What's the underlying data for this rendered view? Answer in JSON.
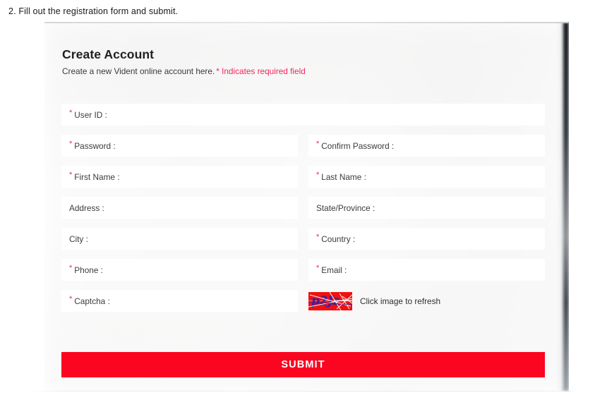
{
  "caption": "2. Fill out the registration form and submit.",
  "form": {
    "title": "Create Account",
    "subtitle": "Create a new Vident online account here.",
    "required_note": "* Indicates required field",
    "required_marker": "*",
    "rows": [
      {
        "left": {
          "label": "User ID :",
          "required": true,
          "value": "",
          "placeholder": ""
        },
        "right": null
      },
      {
        "left": {
          "label": "Password :",
          "required": true,
          "value": "",
          "placeholder": ""
        },
        "right": {
          "label": "Confirm Password :",
          "required": true,
          "value": "",
          "placeholder": ""
        }
      },
      {
        "left": {
          "label": "First Name :",
          "required": true,
          "value": "",
          "placeholder": ""
        },
        "right": {
          "label": "Last Name :",
          "required": true,
          "value": "",
          "placeholder": ""
        }
      },
      {
        "left": {
          "label": "Address :",
          "required": false,
          "value": "",
          "placeholder": ""
        },
        "right": {
          "label": "State/Province :",
          "required": false,
          "value": "",
          "placeholder": ""
        }
      },
      {
        "left": {
          "label": "City :",
          "required": false,
          "value": "",
          "placeholder": ""
        },
        "right": {
          "label": "Country :",
          "required": true,
          "value": "",
          "placeholder": ""
        }
      },
      {
        "left": {
          "label": "Phone :",
          "required": true,
          "value": "",
          "placeholder": ""
        },
        "right": {
          "label": "Email :",
          "required": true,
          "value": "",
          "placeholder": ""
        }
      }
    ],
    "captcha": {
      "label": "Captcha :",
      "required": true,
      "value": "",
      "image_text": "p2Jz",
      "refresh_hint": "Click image to refresh"
    },
    "submit_label": "SUBMIT"
  },
  "colors": {
    "required_star": "#e8294f",
    "required_note": "#f1275c",
    "submit_bg": "#fb0521",
    "submit_text": "#ffffff",
    "captcha_bg": "#f01010",
    "captcha_text": "#3a1f9e",
    "field_bg": "#ffffff",
    "label_text": "#3b3b3b"
  }
}
